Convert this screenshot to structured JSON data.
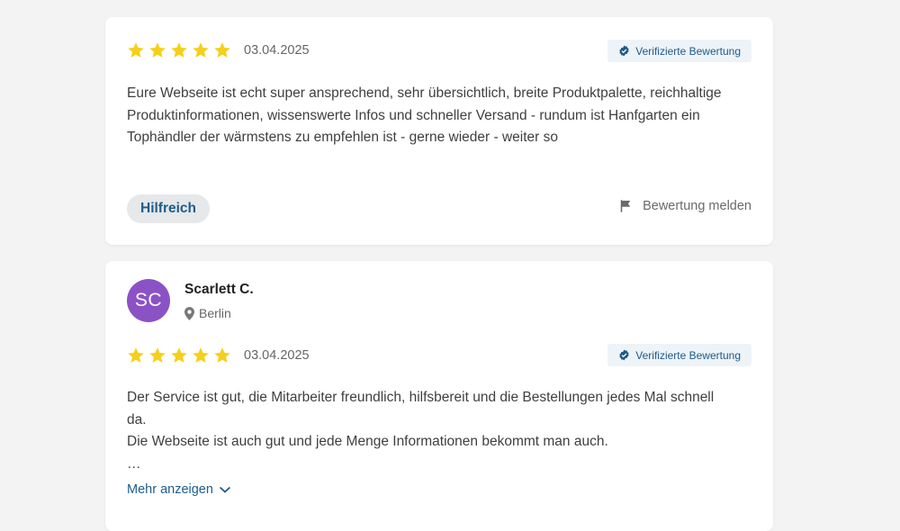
{
  "reviews": [
    {
      "rating": 5,
      "date": "03.04.2025",
      "verified_label": "Verifizierte Bewertung",
      "text_lines": [
        "Eure Webseite ist echt super ansprechend, sehr übersichtlich, breite Produktpalette, reichhaltige",
        "Produktinformationen, wissenswerte Infos und schneller Versand - rundum ist Hanfgarten ein",
        "Tophändler der wärmstens zu empfehlen ist - gerne wieder - weiter so"
      ],
      "helpful_label": "Hilfreich",
      "report_label": "Bewertung melden"
    },
    {
      "author_initials": "SC",
      "author_name": "Scarlett C.",
      "location": "Berlin",
      "rating": 5,
      "date": "03.04.2025",
      "verified_label": "Verifizierte Bewertung",
      "text_lines": [
        "Der Service ist gut, die Mitarbeiter freundlich, hilfsbereit und die Bestellungen jedes Mal schnell",
        "da.",
        "Die Webseite ist auch gut und jede Menge Informationen bekommt man auch.",
        "…"
      ],
      "more_label": "Mehr anzeigen"
    }
  ],
  "colors": {
    "star": "#f5d01b",
    "accent": "#1d5d8a",
    "avatar": "#8b52c6",
    "verified_bg": "#eef3f8"
  },
  "icons": {
    "star": "star-icon",
    "verified": "verified-badge-icon",
    "report": "flag-icon",
    "location": "map-pin-icon",
    "expand": "chevron-down-icon"
  }
}
